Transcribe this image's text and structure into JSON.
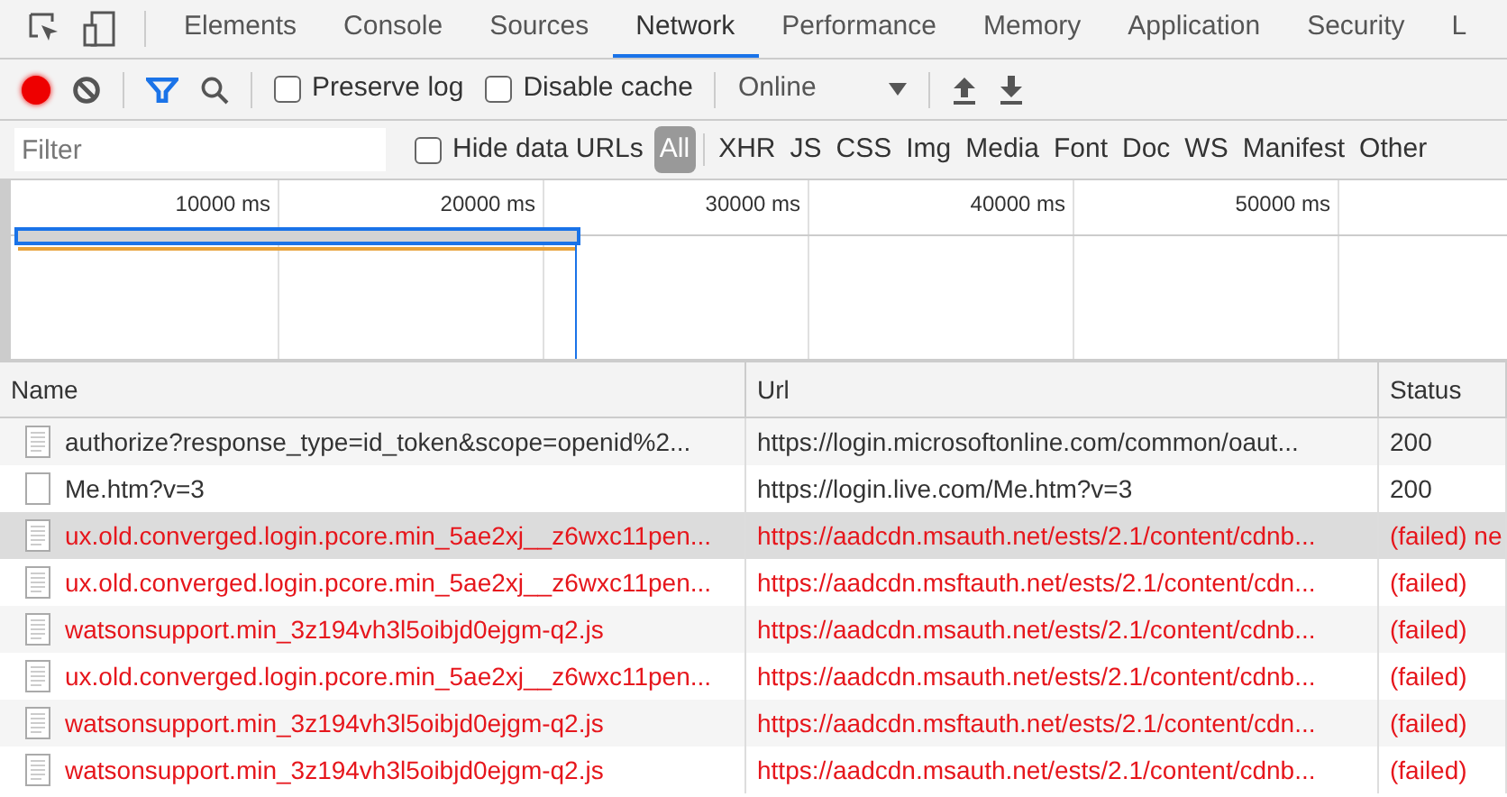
{
  "tabs": [
    {
      "label": "Elements",
      "selected": false
    },
    {
      "label": "Console",
      "selected": false
    },
    {
      "label": "Sources",
      "selected": false
    },
    {
      "label": "Network",
      "selected": true
    },
    {
      "label": "Performance",
      "selected": false
    },
    {
      "label": "Memory",
      "selected": false
    },
    {
      "label": "Application",
      "selected": false
    },
    {
      "label": "Security",
      "selected": false
    },
    {
      "label": "L",
      "selected": false
    }
  ],
  "toolbar": {
    "recording": true,
    "filter_active": true,
    "preserve_log": {
      "label": "Preserve log",
      "checked": false
    },
    "disable_cache": {
      "label": "Disable cache",
      "checked": false
    },
    "throttling": "Online"
  },
  "filter_bar": {
    "placeholder": "Filter",
    "hide_data_urls": {
      "label": "Hide data URLs",
      "checked": false
    },
    "types": [
      {
        "label": "All",
        "selected": true
      },
      {
        "label": "XHR",
        "selected": false
      },
      {
        "label": "JS",
        "selected": false
      },
      {
        "label": "CSS",
        "selected": false
      },
      {
        "label": "Img",
        "selected": false
      },
      {
        "label": "Media",
        "selected": false
      },
      {
        "label": "Font",
        "selected": false
      },
      {
        "label": "Doc",
        "selected": false
      },
      {
        "label": "WS",
        "selected": false
      },
      {
        "label": "Manifest",
        "selected": false
      },
      {
        "label": "Other",
        "selected": false
      }
    ]
  },
  "timeline": {
    "ticks": [
      "10000 ms",
      "20000 ms",
      "30000 ms",
      "40000 ms",
      "50000 ms"
    ]
  },
  "table": {
    "columns": [
      "Name",
      "Url",
      "Status"
    ],
    "rows": [
      {
        "kind": "document",
        "name": "authorize?response_type=id_token&scope=openid%2...",
        "url": "https://login.microsoftonline.com/common/oaut...",
        "status": "200",
        "failed": false,
        "selected": false
      },
      {
        "kind": "blank",
        "name": "Me.htm?v=3",
        "url": "https://login.live.com/Me.htm?v=3",
        "status": "200",
        "failed": false,
        "selected": false
      },
      {
        "kind": "document",
        "name": "ux.old.converged.login.pcore.min_5ae2xj__z6wxc11pen...",
        "url": "https://aadcdn.msauth.net/ests/2.1/content/cdnb...",
        "status": "(failed) ne",
        "failed": true,
        "selected": true
      },
      {
        "kind": "document",
        "name": "ux.old.converged.login.pcore.min_5ae2xj__z6wxc11pen...",
        "url": "https://aadcdn.msftauth.net/ests/2.1/content/cdn...",
        "status": "(failed)",
        "failed": true,
        "selected": false
      },
      {
        "kind": "document",
        "name": "watsonsupport.min_3z194vh3l5oibjd0ejgm-q2.js",
        "url": "https://aadcdn.msauth.net/ests/2.1/content/cdnb...",
        "status": "(failed)",
        "failed": true,
        "selected": false
      },
      {
        "kind": "document",
        "name": "ux.old.converged.login.pcore.min_5ae2xj__z6wxc11pen...",
        "url": "https://aadcdn.msauth.net/ests/2.1/content/cdnb...",
        "status": "(failed)",
        "failed": true,
        "selected": false
      },
      {
        "kind": "document",
        "name": "watsonsupport.min_3z194vh3l5oibjd0ejgm-q2.js",
        "url": "https://aadcdn.msftauth.net/ests/2.1/content/cdn...",
        "status": "(failed)",
        "failed": true,
        "selected": false
      },
      {
        "kind": "document",
        "name": "watsonsupport.min_3z194vh3l5oibjd0ejgm-q2.js",
        "url": "https://aadcdn.msauth.net/ests/2.1/content/cdnb...",
        "status": "(failed)",
        "failed": true,
        "selected": false
      }
    ]
  }
}
